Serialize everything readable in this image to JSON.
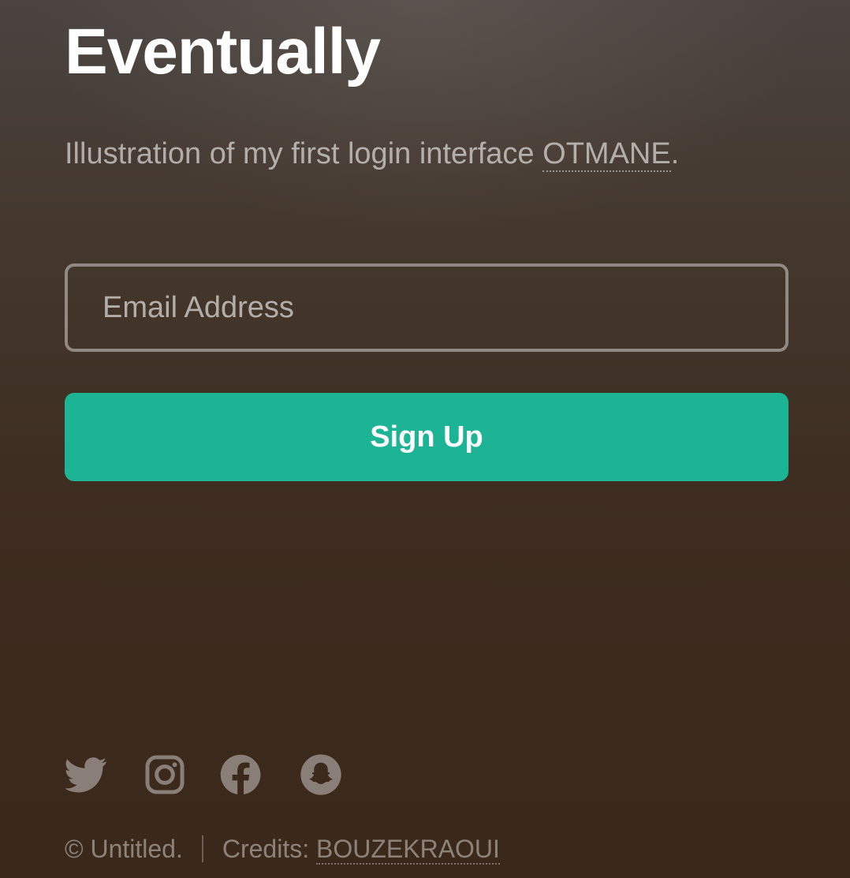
{
  "header": {
    "title": "Eventually",
    "subtitle_text": "Illustration of my first login interface ",
    "subtitle_link": "OTMANE",
    "subtitle_end": "."
  },
  "form": {
    "email_placeholder": "Email Address",
    "email_value": "",
    "submit_label": "Sign Up"
  },
  "social": {
    "icons": [
      "twitter-icon",
      "instagram-icon",
      "facebook-icon",
      "snapchat-icon"
    ],
    "color": "#8a7f78"
  },
  "footer": {
    "copyright": "© Untitled.",
    "credits_label": "Credits: ",
    "credits_link": "BOUZEKRAOUI"
  },
  "colors": {
    "accent": "#1cb495",
    "title": "#ffffff"
  }
}
